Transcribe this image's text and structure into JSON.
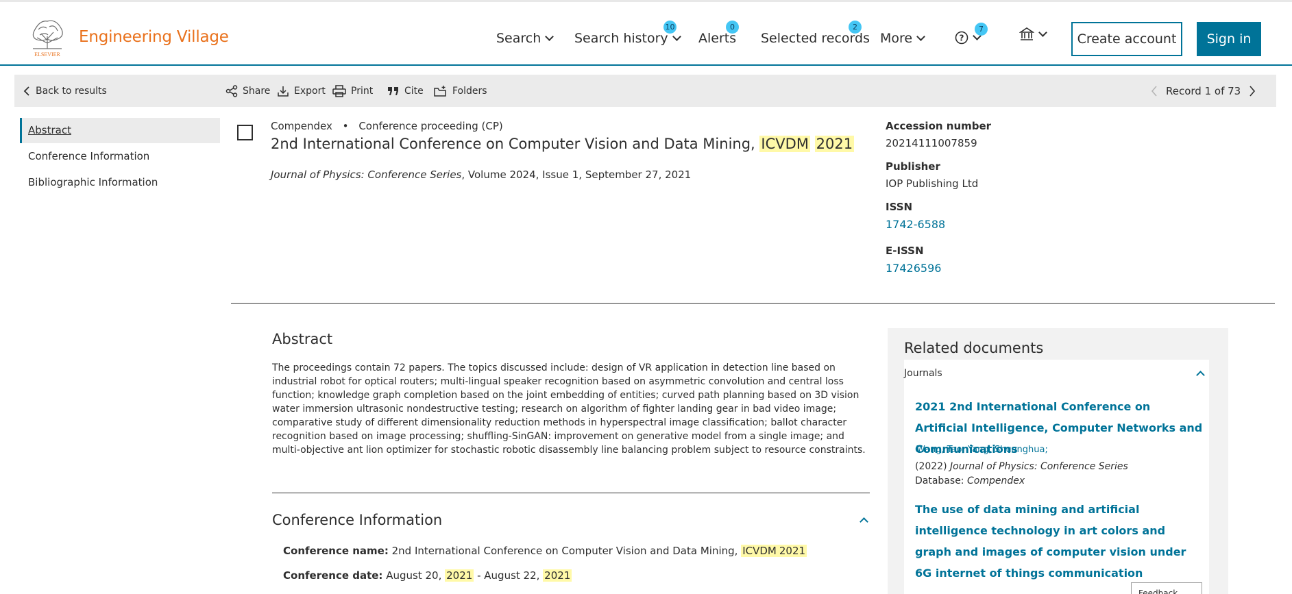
{
  "header": {
    "brand": "Engineering Village",
    "logo_text": "ELSEVIER",
    "nav": {
      "search": "Search",
      "search_history": "Search history",
      "search_history_count": "10",
      "alerts": "Alerts",
      "alerts_count": "0",
      "selected_records": "Selected records",
      "selected_records_count": "2",
      "more": "More",
      "help_count": "7"
    },
    "create_account": "Create account",
    "sign_in": "Sign in"
  },
  "toolbar": {
    "back": "Back to results",
    "share": "Share",
    "export": "Export",
    "print": "Print",
    "cite": "Cite",
    "folders": "Folders",
    "record_nav": "Record 1 of 73"
  },
  "left_nav": {
    "items": [
      "Abstract",
      "Conference Information",
      "Bibliographic Information"
    ]
  },
  "record": {
    "database": "Compendex",
    "doc_type": "Conference proceeding (CP)",
    "title_main": "2nd International Conference on Computer Vision and Data Mining,",
    "title_hl1": "ICVDM",
    "title_hl2": "2021",
    "journal": "Journal of Physics: Conference Series",
    "journal_rest": ", Volume 2024, Issue 1, September 27, 2021"
  },
  "side_info": {
    "accession_label": "Accession number",
    "accession_value": "20214111007859",
    "publisher_label": "Publisher",
    "publisher_value": "IOP Publishing Ltd",
    "issn_label": "ISSN",
    "issn_value": "1742-6588",
    "eissn_label": "E-ISSN",
    "eissn_value": "17426596"
  },
  "abstract": {
    "heading": "Abstract",
    "text": "The proceedings contain 72 papers. The topics discussed include: design of VR application in detection line based on industrial robot for optical routers; multi-lingual speaker recognition based on asymmetric convolution and central loss function; knowledge graph completion based on the joint embedding of entities; curved path planning based on 3D vision water immersion ultrasonic nondestructive testing; research on algorithm of fighter landing gear in bad video image; comparative study of different dimensionality reduction methods in hyperspectral image classification; ballot character recognition based on image processing; shuffling-SinGAN: improvement on generative model from a single image; and multi-objective ant lion optimizer for stochastic robotic disassembly line balancing problem subject to resource constraints."
  },
  "conference": {
    "heading": "Conference Information",
    "name_label": "Conference name:",
    "name_value": "2nd International Conference on Computer Vision and Data Mining,",
    "name_hl1": "ICVDM",
    "name_hl2": "2021",
    "date_label": "Conference date:",
    "date_part1": "August 20,",
    "date_hl1": "2021",
    "date_part2": "- August 22,",
    "date_hl2": "2021"
  },
  "related": {
    "heading": "Related documents",
    "section": "Journals",
    "doc1_title": "2021 2nd International Conference on Artificial Intelligence, Computer Networks and Communications",
    "doc1_authors": "Wang, Tao; Yang, Shuanghua;",
    "doc1_year": "(2022)",
    "doc1_journal": "Journal of Physics: Conference Series",
    "doc1_db_label": "Database:",
    "doc1_db": "Compendex",
    "doc2_title": "The use of data mining and artificial intelligence technology in art colors and graph and images of computer vision under 6G internet of things communication"
  },
  "feedback": "Feedback"
}
